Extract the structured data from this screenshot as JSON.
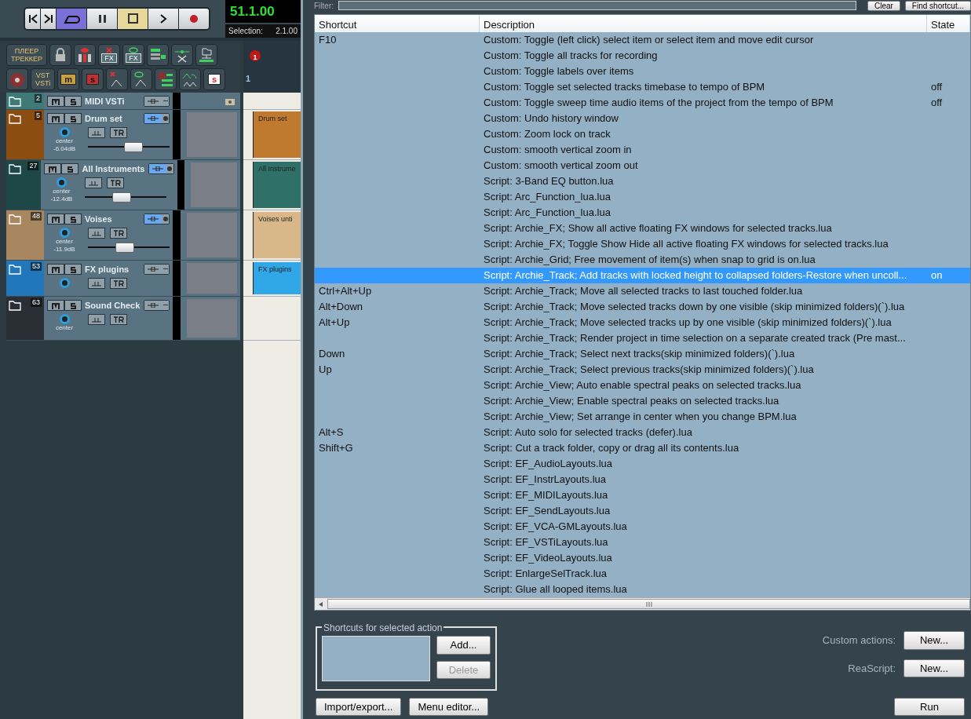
{
  "transport": {
    "buttons": [
      {
        "kind": "start",
        "on": false
      },
      {
        "kind": "end",
        "on": false
      },
      {
        "kind": "repeat",
        "on": true
      },
      {
        "kind": "pause",
        "on": false
      },
      {
        "kind": "stop",
        "on": true
      },
      {
        "kind": "play",
        "on": false
      },
      {
        "kind": "record",
        "on": false
      }
    ],
    "time": "51.1.00",
    "selection_label": "Selection:",
    "selection": "2.1.00"
  },
  "toolbar": [
    [
      {
        "kind": "text",
        "lines": [
          "ПЛЕЕР",
          "ТРЕККЕР"
        ]
      },
      {
        "kind": "lock"
      },
      {
        "kind": "mixer"
      },
      {
        "kind": "fxclose",
        "label": "FX"
      },
      {
        "kind": "fxshow",
        "label": "FX"
      },
      {
        "kind": "tracklock"
      },
      {
        "kind": "split"
      },
      {
        "kind": "folders"
      }
    ],
    [
      {
        "kind": "disc"
      },
      {
        "kind": "text",
        "lines": [
          "VST",
          "VSTi"
        ]
      },
      {
        "kind": "mute",
        "label": "m"
      },
      {
        "kind": "solo",
        "label": "s"
      },
      {
        "kind": "envclose"
      },
      {
        "kind": "envshow"
      },
      {
        "kind": "disclist"
      },
      {
        "kind": "envcopy"
      },
      {
        "kind": "solored",
        "label": "s"
      }
    ]
  ],
  "timeline": {
    "marker": "1",
    "bar": "1"
  },
  "tracks": [
    {
      "kind": "compact",
      "number": "2",
      "name": "MIDI VSTi",
      "color": "#3d7a78",
      "route_on": false
    },
    {
      "kind": "full",
      "number": "5",
      "name": "Drum set",
      "color": "#8c4d12",
      "route_on": true,
      "pan": "center",
      "volume": "-6.04dB",
      "level": 0.56,
      "item": {
        "label": "Drum set",
        "color": "#c07a30"
      }
    },
    {
      "kind": "full",
      "number": "27",
      "name": "All Instruments",
      "color": "#1e4848",
      "route_on": true,
      "pan": "center",
      "volume": "-12.4dB",
      "level": 0.45,
      "item": {
        "label": "All Instrume",
        "color": "#2f7068"
      }
    },
    {
      "kind": "full",
      "number": "48",
      "name": "Voises",
      "color": "#a88760",
      "route_on": true,
      "pan": "center",
      "volume": "-11.9dB",
      "level": 0.45,
      "item": {
        "label": "Voises unti",
        "color": "#d8b888"
      }
    },
    {
      "kind": "short",
      "number": "53",
      "name": "FX plugins",
      "color": "#2277bb",
      "route_on": false,
      "item": {
        "label": "FX plugins",
        "color": "#30a8e8"
      }
    },
    {
      "kind": "medium",
      "number": "63",
      "name": "Sound Check",
      "color": "#2a2f36",
      "route_on": false,
      "pan": "center"
    }
  ],
  "filter": {
    "label": "Filter:",
    "buttons": [
      "Clear",
      "Find shortcut..."
    ]
  },
  "table": {
    "columns": [
      "Shortcut",
      "Description",
      "State"
    ],
    "rows": [
      {
        "shortcut": "F10",
        "description": "Custom: Toggle (left click) select item or select item and move edit cursor",
        "selected": false
      },
      {
        "description": "Custom: Toggle all tracks for recording",
        "selected": false
      },
      {
        "description": "Custom: Toggle labels over items",
        "selected": false
      },
      {
        "description": "Custom: Toggle set selected tracks timebase to tempo of BPM",
        "state": "off",
        "selected": false
      },
      {
        "description": "Custom: Toggle sweep time audio items of the project from the tempo of BPM",
        "state": "off",
        "selected": false
      },
      {
        "description": "Custom: Undo history window",
        "selected": false
      },
      {
        "description": "Custom: Zoom lock on track",
        "selected": false
      },
      {
        "description": "Custom: smooth vertical zoom in",
        "selected": false
      },
      {
        "description": "Custom: smooth vertical zoom out",
        "selected": false
      },
      {
        "description": "Script: 3-Band EQ button.lua",
        "selected": false
      },
      {
        "description": "Script: Arc_Function_lua.lua",
        "selected": false
      },
      {
        "description": "Script: Arc_Function_lua.lua",
        "selected": false
      },
      {
        "description": "Script: Archie_FX;  Show all active floating FX windows for selected tracks.lua",
        "selected": false
      },
      {
        "description": "Script: Archie_FX;  Toggle Show Hide all active floating FX windows for selected tracks.lua",
        "selected": false
      },
      {
        "description": "Script: Archie_Grid; Free movement of item(s) when snap to grid is on.lua",
        "selected": false
      },
      {
        "description": "Script: Archie_Track;  Add tracks with locked height to collapsed folders-Restore when uncoll...",
        "state": "on",
        "selected": true
      },
      {
        "shortcut": "Ctrl+Alt+Up",
        "description": "Script: Archie_Track;  Move all selected tracks to last touched folder.lua",
        "selected": false
      },
      {
        "shortcut": "Alt+Down",
        "description": "Script: Archie_Track;  Move selected tracks down by one visible (skip minimized folders)(`).lua",
        "selected": false
      },
      {
        "shortcut": "Alt+Up",
        "description": "Script: Archie_Track;  Move selected tracks up by one visible (skip minimized folders)(`).lua",
        "selected": false
      },
      {
        "description": "Script: Archie_Track;  Render project in time selection on a separate created track (Pre mast...",
        "selected": false
      },
      {
        "shortcut": "Down",
        "description": "Script: Archie_Track;  Select next tracks(skip minimized folders)(`).lua",
        "selected": false
      },
      {
        "shortcut": "Up",
        "description": "Script: Archie_Track;  Select previous tracks(skip minimized folders)(`).lua",
        "selected": false
      },
      {
        "description": "Script: Archie_View;  Auto enable spectral peaks on selected tracks.lua",
        "selected": false
      },
      {
        "description": "Script: Archie_View;  Enable spectral peaks on selected tracks.lua",
        "selected": false
      },
      {
        "description": "Script: Archie_View;  Set arrange in center when you change BPM.lua",
        "selected": false
      },
      {
        "shortcut": "Alt+S",
        "description": "Script: Auto solo for selected tracks (defer).lua",
        "selected": false
      },
      {
        "shortcut": "Shift+G",
        "description": "Script: Cut a track folder, copy or drag all its contents.lua",
        "selected": false
      },
      {
        "description": "Script: EF_AudioLayouts.lua",
        "selected": false
      },
      {
        "description": "Script: EF_InstrLayouts.lua",
        "selected": false
      },
      {
        "description": "Script: EF_MIDILayouts.lua",
        "selected": false
      },
      {
        "description": "Script: EF_SendLayouts.lua",
        "selected": false
      },
      {
        "description": "Script: EF_VCA-GMLayouts.lua",
        "selected": false
      },
      {
        "description": "Script: EF_VSTiLayouts.lua",
        "selected": false
      },
      {
        "description": "Script: EF_VideoLayouts.lua",
        "selected": false
      },
      {
        "description": "Script: EnlargeSelTrack.lua",
        "selected": false
      },
      {
        "description": "Script: Glue all looped items.lua",
        "selected": false
      }
    ]
  },
  "shortcuts_group": {
    "title": "Shortcuts for selected action",
    "buttons": [
      {
        "label": "Add...",
        "disabled": false
      },
      {
        "label": "Delete",
        "disabled": true
      }
    ]
  },
  "actions": [
    {
      "label": "Custom actions:",
      "button": "New..."
    },
    {
      "label": "ReaScript:",
      "button": "New..."
    }
  ],
  "footer": {
    "left": [
      "Import/export...",
      "Menu editor..."
    ],
    "run": "Run"
  }
}
